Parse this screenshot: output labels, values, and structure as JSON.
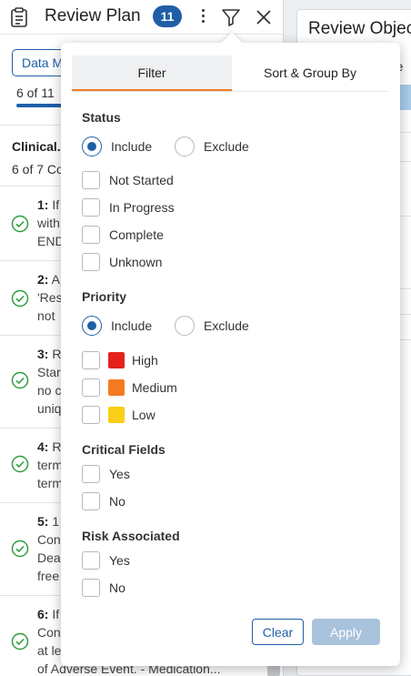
{
  "review_plan": {
    "title": "Review Plan",
    "count": "11",
    "data_button": "Data M",
    "progress_text": "6 of 11",
    "progress": 0.55,
    "group": {
      "title": "Clinical...",
      "subtitle": "6 of 7 Co"
    },
    "items": [
      {
        "num": "1:",
        "lines": [
          "If",
          "with",
          "END"
        ]
      },
      {
        "num": "2:",
        "lines": [
          "A",
          "'Res",
          "not"
        ]
      },
      {
        "num": "3:",
        "lines": [
          "R",
          "Star",
          "no c",
          "uniq"
        ]
      },
      {
        "num": "4:",
        "lines": [
          "R",
          "term",
          "term"
        ]
      },
      {
        "num": "5:",
        "lines": [
          "1",
          "Con",
          "Dea",
          "free"
        ]
      },
      {
        "num": "6:",
        "lines": [
          "If",
          "Con",
          "at le",
          "of Adverse Event. - Medication..."
        ]
      }
    ]
  },
  "review_objects": {
    "title": "Review Objec",
    "column_fragment": "Ve"
  },
  "filter": {
    "tabs": [
      "Filter",
      "Sort & Group By"
    ],
    "active_tab": "Filter",
    "status": {
      "title": "Status",
      "include": "Include",
      "exclude": "Exclude",
      "mode": "include",
      "options": [
        "Not Started",
        "In Progress",
        "Complete",
        "Unknown"
      ]
    },
    "priority": {
      "title": "Priority",
      "include": "Include",
      "exclude": "Exclude",
      "mode": "include",
      "options": [
        {
          "label": "High",
          "color": "#e3231b"
        },
        {
          "label": "Medium",
          "color": "#f47b20"
        },
        {
          "label": "Low",
          "color": "#f9cf17"
        }
      ]
    },
    "critical_fields": {
      "title": "Critical Fields",
      "options": [
        "Yes",
        "No"
      ]
    },
    "risk_associated": {
      "title": "Risk Associated",
      "options": [
        "Yes",
        "No"
      ]
    },
    "clear_label": "Clear",
    "apply_label": "Apply"
  },
  "colors": {
    "accent": "#1f5fa8",
    "tab_underline": "#f07b22",
    "complete_check": "#2e9e3e"
  },
  "icons": [
    "clipboard-icon",
    "more-vertical-icon",
    "filter-icon",
    "close-icon",
    "check-circle-icon"
  ]
}
